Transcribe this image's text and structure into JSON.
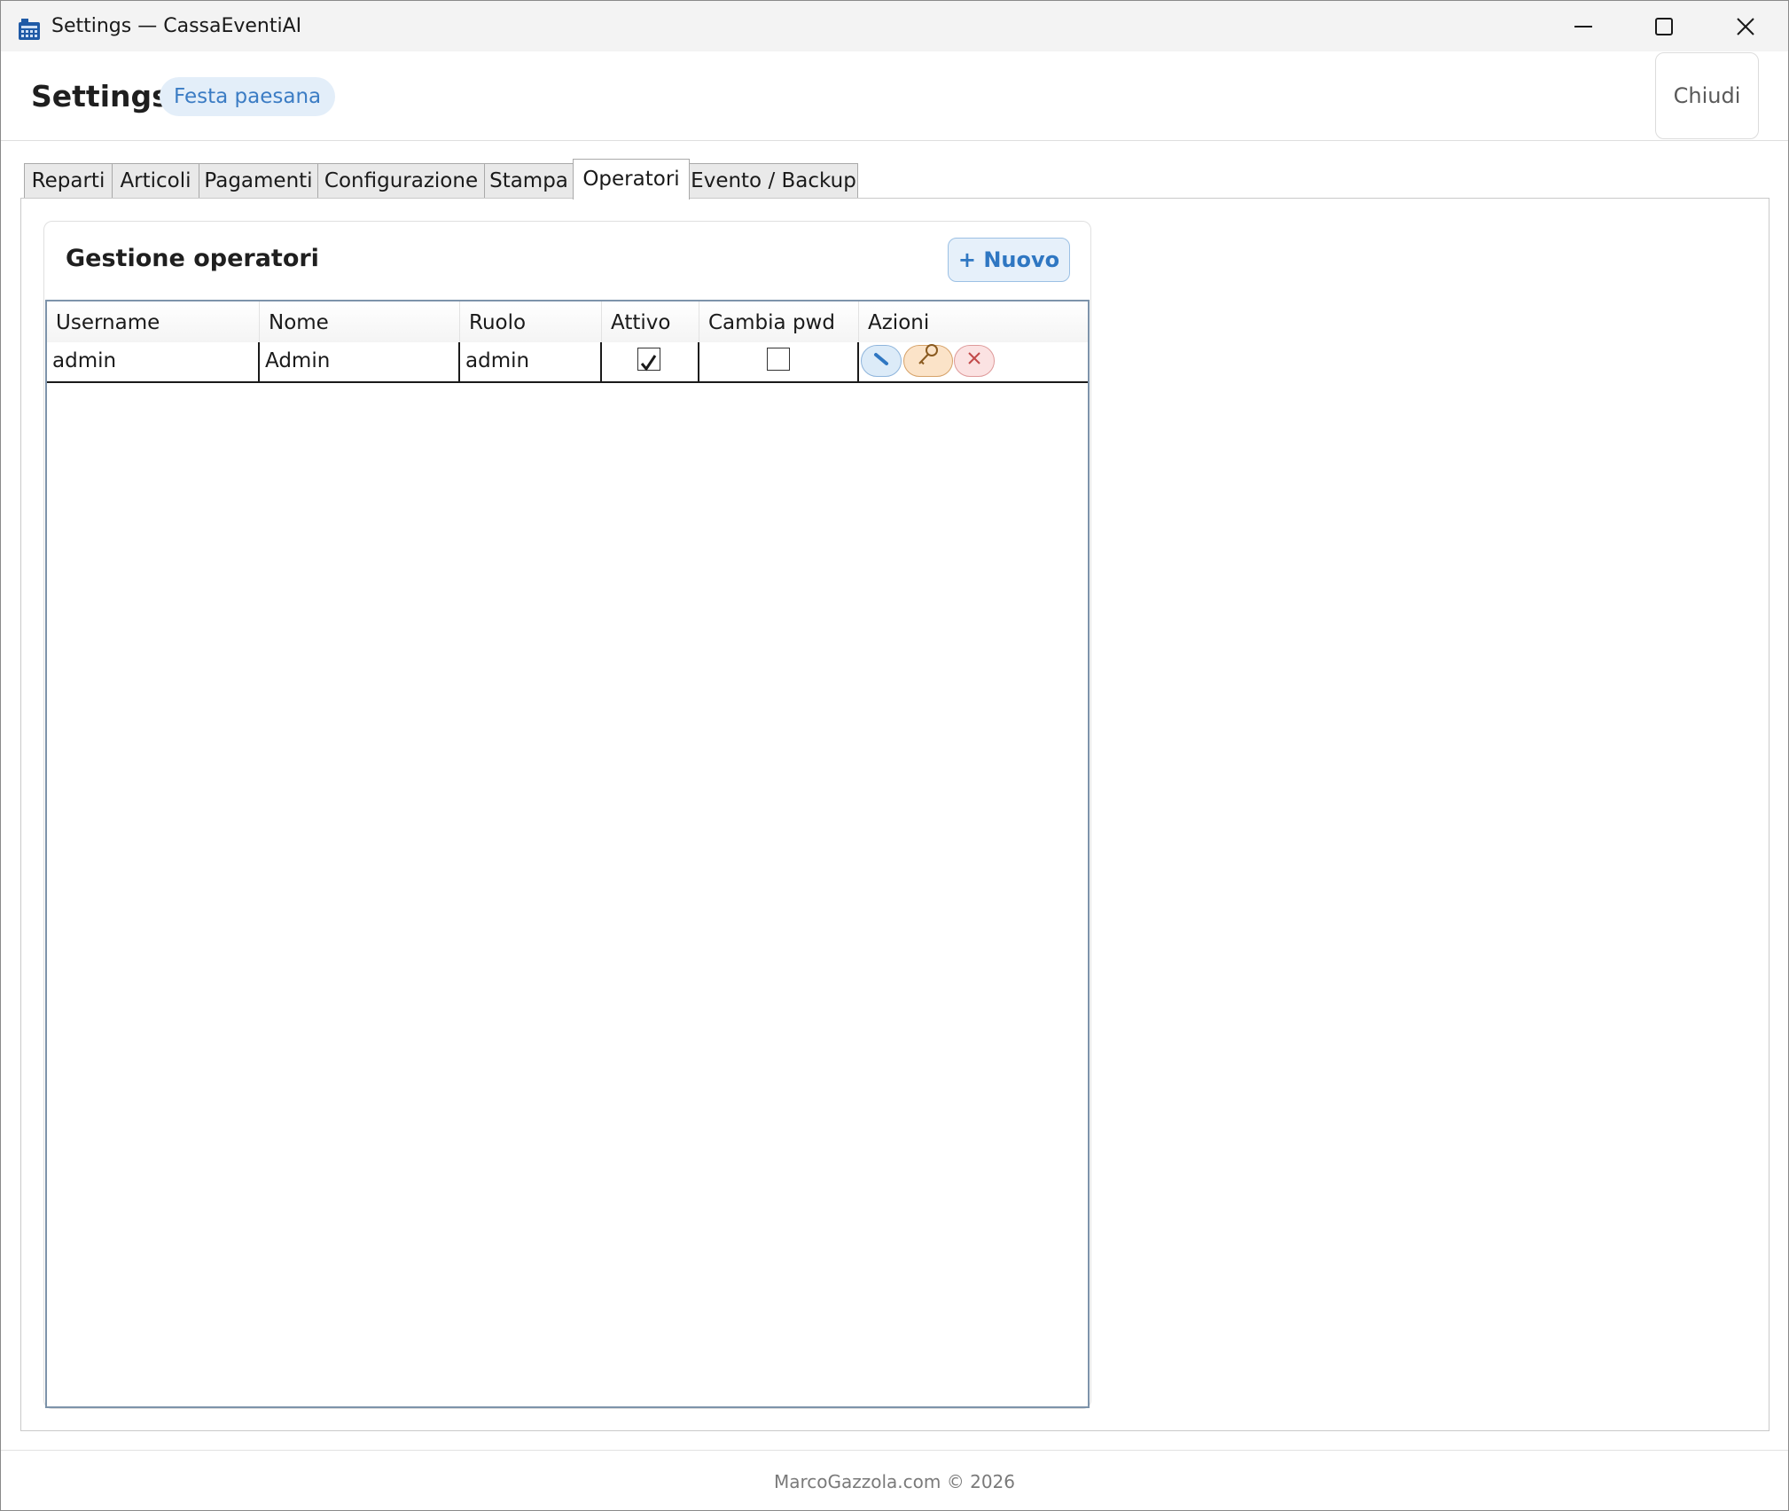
{
  "window": {
    "title": "Settings — CassaEventiAI",
    "controls": [
      "minimize",
      "maximize",
      "close"
    ]
  },
  "header": {
    "title": "Settings",
    "event_badge": "Festa paesana",
    "close_label": "Chiudi"
  },
  "tabs": [
    {
      "label": "Reparti",
      "active": false
    },
    {
      "label": "Articoli",
      "active": false
    },
    {
      "label": "Pagamenti",
      "active": false
    },
    {
      "label": "Configurazione",
      "active": false
    },
    {
      "label": "Stampa",
      "active": false
    },
    {
      "label": "Operatori",
      "active": true
    },
    {
      "label": "Evento / Backup",
      "active": false
    }
  ],
  "operators": {
    "title": "Gestione operatori",
    "new_label": "+ Nuovo",
    "columns": [
      "Username",
      "Nome",
      "Ruolo",
      "Attivo",
      "Cambia pwd",
      "Azioni"
    ],
    "rows": [
      {
        "username": "admin",
        "nome": "Admin",
        "ruolo": "admin",
        "attivo": true,
        "cambia_pwd": false,
        "actions": [
          "edit-icon",
          "key-icon",
          "delete-icon"
        ]
      }
    ]
  },
  "colors": {
    "accent": "#2f77c2",
    "badge_bg": "#e3eef9",
    "key_button": "#fbe3c8",
    "delete_button": "#fbe2e2"
  },
  "footer": {
    "text": "MarcoGazzola.com © 2026"
  }
}
